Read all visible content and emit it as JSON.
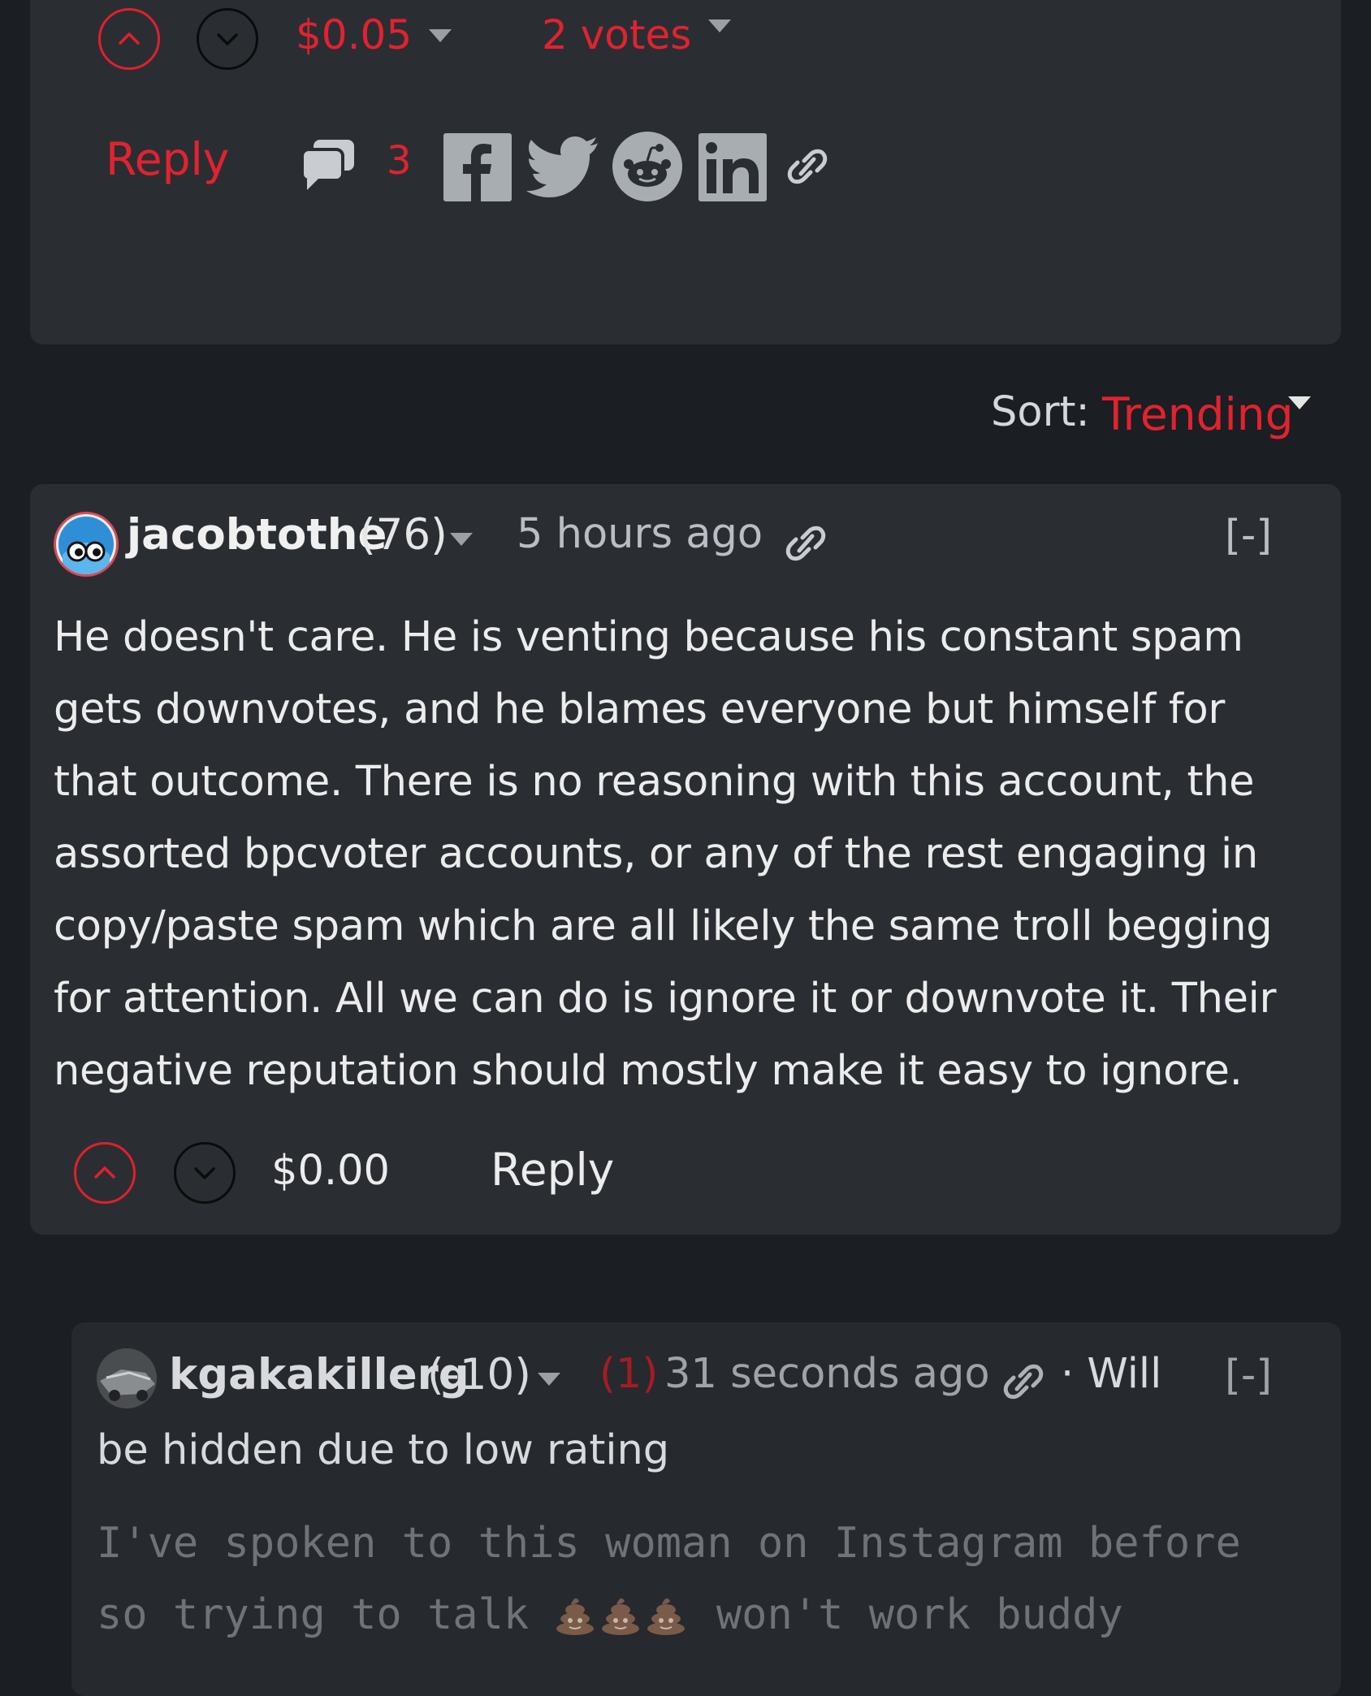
{
  "top_post": {
    "payout": "$0.05",
    "votes": "2 votes",
    "reply_label": "Reply",
    "comment_count": "3"
  },
  "sort": {
    "label": "Sort:",
    "value": "Trending"
  },
  "comment": {
    "author": "jacobtothe",
    "reputation": "(76)",
    "time": "5 hours ago",
    "collapse": "[-]",
    "body": "He doesn't care. He is venting because his constant spam gets downvotes, and he blames everyone but himself for that outcome. There is no reasoning with this account, the assorted bpcvoter accounts, or any of the rest engaging in copy/paste spam which are all likely the same troll begging for attention. All we can do is ignore it or downvote it. Their negative reputation should mostly make it easy to ignore.",
    "payout": "$0.00",
    "reply_label": "Reply"
  },
  "reply_comment": {
    "author": "kgakakillerg",
    "reputation": "(-10)",
    "flag_count": "(1)",
    "time": "31 seconds ago",
    "hidden_notice_1": "· Will",
    "hidden_notice_2": "be hidden due to low rating",
    "collapse": "[-]",
    "body_1": "I've spoken to this woman on Instagram before",
    "body_2a": "so trying to talk",
    "body_2b": "won't work buddy"
  },
  "colors": {
    "accent": "#e2222f",
    "card": "#2a2e33",
    "background": "#1b1e22"
  }
}
